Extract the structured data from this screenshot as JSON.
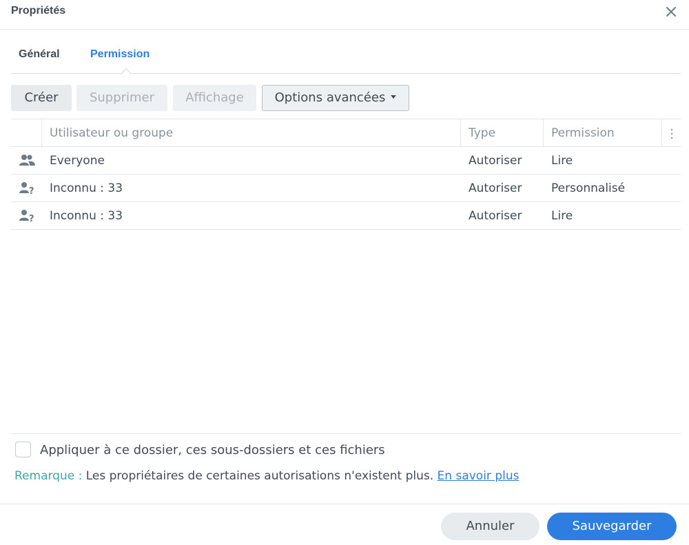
{
  "dialog": {
    "title": "Propriétés",
    "close_icon": "close-icon"
  },
  "tabs": [
    {
      "label": "Général",
      "active": false
    },
    {
      "label": "Permission",
      "active": true
    }
  ],
  "toolbar": {
    "create_label": "Créer",
    "delete_label": "Supprimer",
    "view_label": "Affichage",
    "advanced_label": "Options avancées"
  },
  "grid": {
    "columns": [
      "Utilisateur ou groupe",
      "Type",
      "Permission"
    ],
    "rows": [
      {
        "icon": "group-icon",
        "name": "Everyone",
        "type": "Autoriser",
        "permission": "Lire"
      },
      {
        "icon": "unknown-user-icon",
        "name": "Inconnu : 33",
        "type": "Autoriser",
        "permission": "Personnalisé"
      },
      {
        "icon": "unknown-user-icon",
        "name": "Inconnu : 33",
        "type": "Autoriser",
        "permission": "Lire"
      }
    ]
  },
  "apply": {
    "checked": false,
    "label": "Appliquer à ce dossier, ces sous-dossiers et ces fichiers"
  },
  "remark": {
    "label": "Remarque :",
    "text": "Les propriétaires de certaines autorisations n'existent plus.",
    "link": "En savoir plus"
  },
  "footer": {
    "cancel_label": "Annuler",
    "save_label": "Sauvegarder"
  },
  "colors": {
    "accent": "#2e7de1",
    "remark_label": "#3fa7a1",
    "text": "#414b55",
    "muted": "#89939b"
  }
}
